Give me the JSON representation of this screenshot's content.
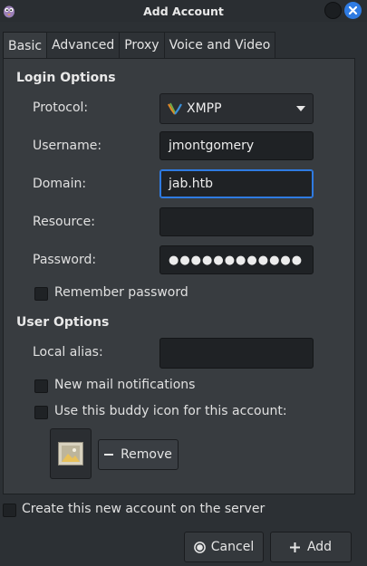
{
  "window": {
    "title": "Add Account"
  },
  "tabs": [
    "Basic",
    "Advanced",
    "Proxy",
    "Voice and Video"
  ],
  "login": {
    "title": "Login Options",
    "protocol_label": "Protocol:",
    "protocol_value": "XMPP",
    "username_label": "Username:",
    "username_value": "jmontgomery",
    "domain_label": "Domain:",
    "domain_value": "jab.htb",
    "resource_label": "Resource:",
    "resource_value": "",
    "password_label": "Password:",
    "password_value": "●●●●●●●●●●●●",
    "remember_label": "Remember password"
  },
  "user": {
    "title": "User Options",
    "alias_label": "Local alias:",
    "alias_value": "",
    "mail_label": "New mail notifications",
    "buddy_icon_label": "Use this buddy icon for this account:",
    "remove_label": "Remove"
  },
  "footer": {
    "create_label": "Create this new account on the server",
    "cancel_label": "Cancel",
    "add_label": "Add"
  },
  "colors": {
    "accent": "#2f7be2",
    "background": "#2c3034",
    "panel": "#383c40"
  }
}
